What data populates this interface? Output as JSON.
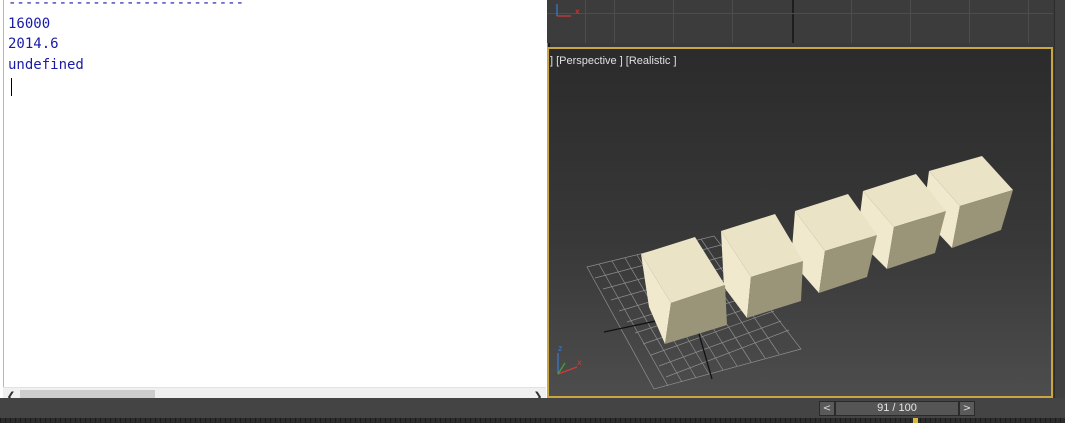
{
  "listener": {
    "lines": [
      "----------------------------",
      "16000",
      "2014.6",
      "undefined"
    ]
  },
  "viewport": {
    "label": "] [Perspective ] [Realistic ]"
  },
  "timeline": {
    "prev_label": "<",
    "next_label": ">",
    "frame_text": "91 / 100"
  },
  "colors": {
    "output_text": "#1a1aa8",
    "active_viewport_border": "#c9a641",
    "cube_top": "#ebe3c5",
    "cube_left": "#f1e9cd",
    "cube_right": "#9a9579"
  }
}
